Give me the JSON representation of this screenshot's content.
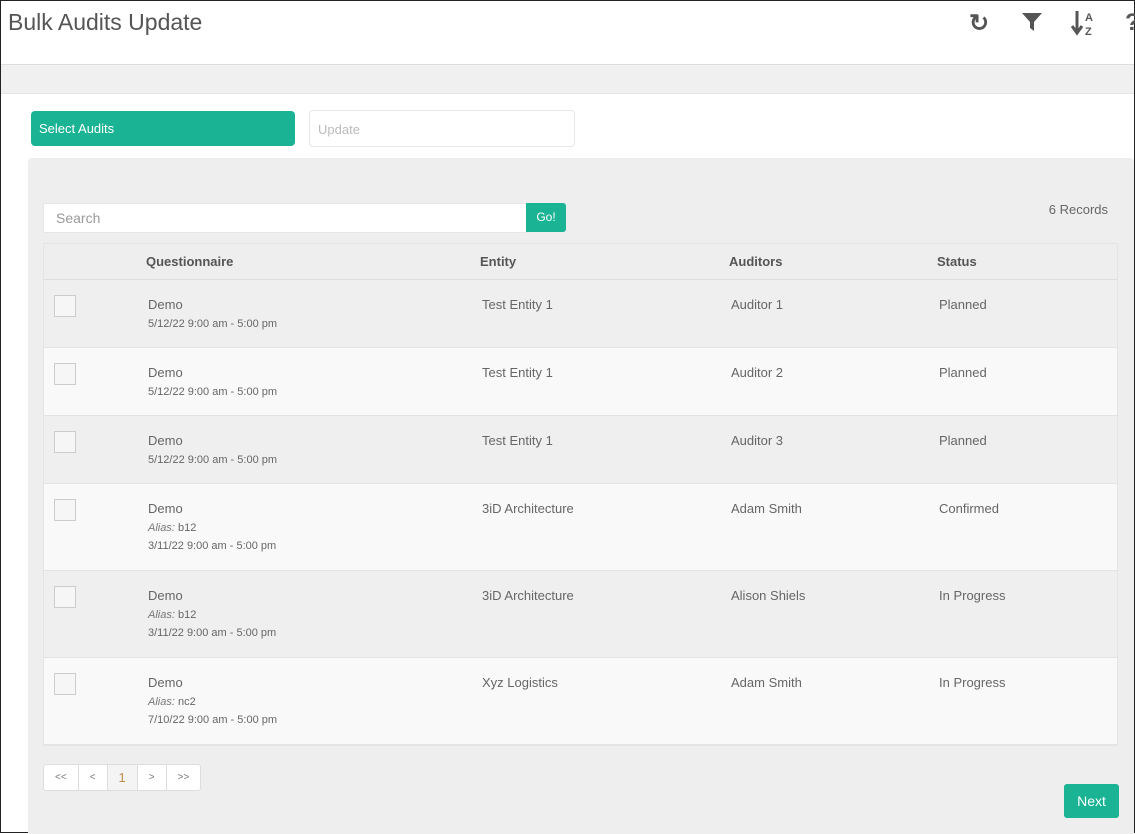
{
  "header": {
    "title": "Bulk Audits Update",
    "icons": [
      "refresh-icon",
      "filter-icon",
      "sort-alpha-icon",
      "help-icon"
    ]
  },
  "toolbar": {
    "select_label": "Select Audits",
    "update_placeholder": "Update"
  },
  "search": {
    "placeholder": "Search",
    "go_label": "Go!",
    "records": "6 Records"
  },
  "table": {
    "columns": [
      "Questionnaire",
      "Entity",
      "Auditors",
      "Status"
    ],
    "rows": [
      {
        "q": "Demo",
        "alias_label": "",
        "alias": "",
        "date": "5/12/22 9:00 am - 5:00 pm",
        "entity": "Test Entity 1",
        "auditor": "Auditor 1",
        "status": "Planned"
      },
      {
        "q": "Demo",
        "alias_label": "",
        "alias": "",
        "date": "5/12/22 9:00 am - 5:00 pm",
        "entity": "Test Entity 1",
        "auditor": "Auditor 2",
        "status": "Planned"
      },
      {
        "q": "Demo",
        "alias_label": "",
        "alias": "",
        "date": "5/12/22 9:00 am - 5:00 pm",
        "entity": "Test Entity 1",
        "auditor": "Auditor 3",
        "status": "Planned"
      },
      {
        "q": "Demo",
        "alias_label": "Alias:",
        "alias": "b12",
        "date": "3/11/22 9:00 am - 5:00 pm",
        "entity": "3iD Architecture",
        "auditor": "Adam Smith",
        "status": "Confirmed"
      },
      {
        "q": "Demo",
        "alias_label": "Alias:",
        "alias": "b12",
        "date": "3/11/22 9:00 am - 5:00 pm",
        "entity": "3iD Architecture",
        "auditor": "Alison Shiels",
        "status": "In Progress"
      },
      {
        "q": "Demo",
        "alias_label": "Alias:",
        "alias": "nc2",
        "date": "7/10/22 9:00 am - 5:00 pm",
        "entity": "Xyz Logistics",
        "auditor": "Adam Smith",
        "status": "In Progress"
      }
    ]
  },
  "pager": {
    "first": "<<",
    "prev": "<",
    "current": "1",
    "next": ">",
    "last": ">>"
  },
  "footer": {
    "next_label": "Next"
  },
  "colors": {
    "accent": "#1ab394"
  }
}
